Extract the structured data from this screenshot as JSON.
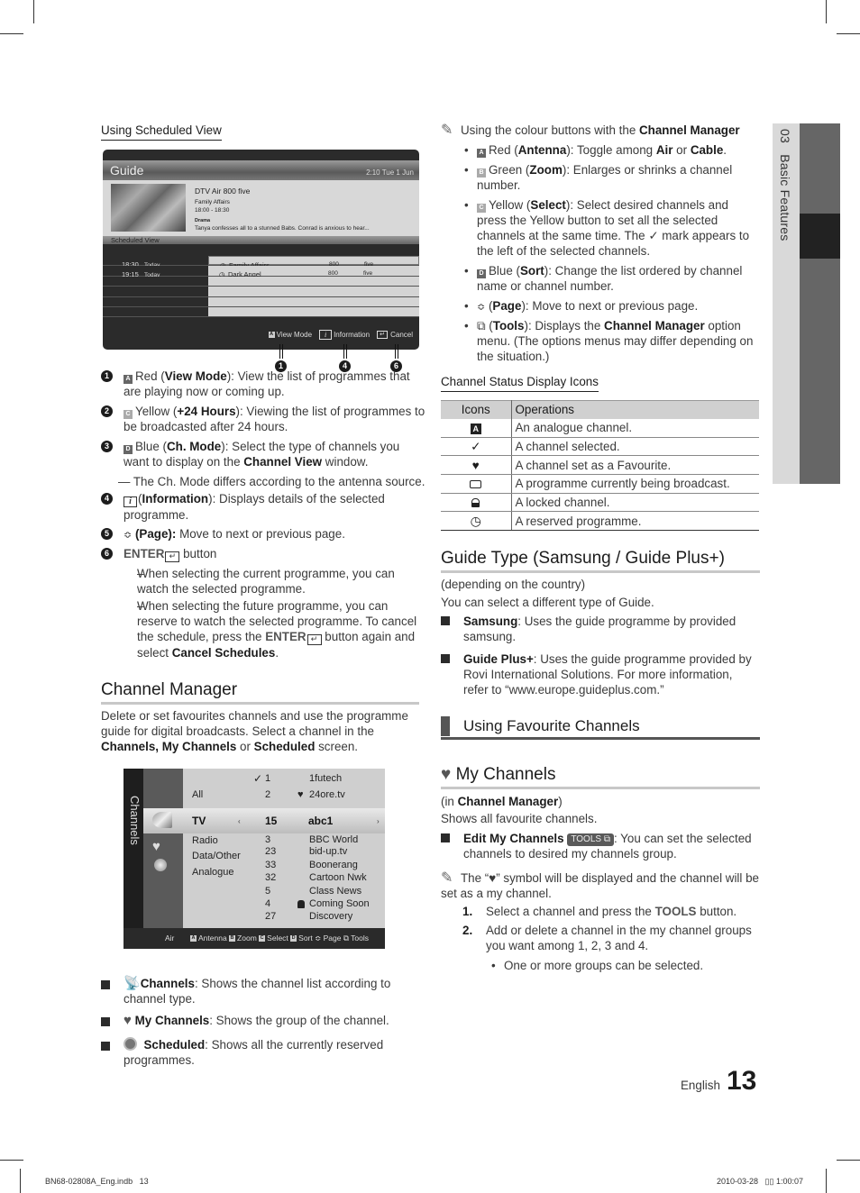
{
  "side_tab": {
    "chapter": "03",
    "title": "Basic Features"
  },
  "left": {
    "scheduled_view_heading": "Using Scheduled View",
    "guide_screen": {
      "title": "Guide",
      "clock": "2:10 Tue 1 Jun",
      "channel": "DTV Air 800 five",
      "programme": "Family Affairs",
      "time": "18:00 - 18:30",
      "genre": "Drama",
      "synopsis": "Tanya confesses all to a stunned Babs. Conrad is anxious to hear...",
      "view_label": "Scheduled View",
      "rows": [
        {
          "time": "18:30",
          "day": "Today",
          "title": "Family Affairs",
          "ch": "800",
          "name": "five"
        },
        {
          "time": "19:15",
          "day": "Today",
          "title": "Dark Angel",
          "ch": "800",
          "name": "five"
        }
      ],
      "footer": {
        "key_a": "A",
        "view_mode": "View Mode",
        "info_glyph": "i",
        "information": "Information",
        "enter_glyph": "↵",
        "cancel": "Cancel"
      },
      "callouts": [
        "1",
        "4",
        "6"
      ]
    },
    "items": [
      {
        "num": "1",
        "key": "A",
        "pre": "Red (",
        "bold": "View Mode",
        "post": "): View the list of programmes that are playing now or coming up."
      },
      {
        "num": "2",
        "key": "C",
        "pre": "Yellow (",
        "bold": "+24 Hours",
        "post": "): Viewing the list of programmes to be broadcasted after 24 hours."
      },
      {
        "num": "3",
        "key": "D",
        "pre": "Blue (",
        "bold": "Ch. Mode",
        "post": "): Select the type of channels you want to display on the ",
        "bold2": "Channel View",
        "post2": " window."
      }
    ],
    "note_ch_mode": "— The Ch. Mode differs according to the antenna source.",
    "item4": {
      "num": "4",
      "glyph": "i",
      "pre": "(",
      "bold": "Information",
      "post": "): Displays details of the selected programme."
    },
    "item5": {
      "num": "5",
      "glyph": "≎",
      "bold": "(Page):",
      "post": " Move to next or previous page."
    },
    "item6": {
      "num": "6",
      "bold": "ENTER",
      "glyph": "↵",
      "post": " button"
    },
    "dash1": "When selecting the current programme, you can watch the selected programme.",
    "dash2_pre": "When selecting the future programme, you can reserve to watch the selected programme. To cancel the schedule, press the ",
    "dash2_bold": "ENTER",
    "dash2_mid": " button again and select ",
    "dash2_bold2": "Cancel Schedules",
    "dash2_end": ".",
    "dash_glyph": "–",
    "channel_manager": {
      "heading": "Channel Manager",
      "intro_pre": "Delete or set favourites channels and use the programme guide for digital broadcasts. Select a channel in the ",
      "intro_bold": "Channels, My Channels",
      "intro_mid": " or ",
      "intro_bold2": "Scheduled",
      "intro_end": " screen."
    },
    "cm_screen": {
      "side_label": "Channels",
      "categories": [
        "All",
        "TV",
        "Radio",
        "Data/Other",
        "Analogue"
      ],
      "rows": [
        {
          "num": "1",
          "name": "1futech",
          "mark": "check"
        },
        {
          "num": "2",
          "name": "24ore.tv",
          "mark": "heart"
        },
        {
          "num": "15",
          "name": "abc1",
          "mark": ""
        },
        {
          "num": "3",
          "name": "BBC World",
          "mark": ""
        },
        {
          "num": "23",
          "name": "bid-up.tv",
          "mark": ""
        },
        {
          "num": "33",
          "name": "Boonerang",
          "mark": ""
        },
        {
          "num": "32",
          "name": "Cartoon Nwk",
          "mark": ""
        },
        {
          "num": "5",
          "name": "Class News",
          "mark": ""
        },
        {
          "num": "4",
          "name": "Coming Soon",
          "mark": "lock"
        },
        {
          "num": "27",
          "name": "Discovery",
          "mark": ""
        }
      ],
      "footer": {
        "source": "Air",
        "a": "A",
        "antenna": "Antenna",
        "b": "B",
        "zoom": "Zoom",
        "c": "C",
        "select": "Select",
        "d": "D",
        "sort": "Sort",
        "page_glyph": "≎",
        "page": "Page",
        "tools": "Tools"
      }
    },
    "bullets": [
      {
        "bold": "Channels",
        "text": ": Shows the channel list according to channel type."
      },
      {
        "bold": "My Channels",
        "text": ": Shows the group of the channel."
      },
      {
        "bold": "Scheduled",
        "text": ": Shows all the currently reserved programmes."
      }
    ]
  },
  "right": {
    "note_pre": "Using the colour buttons with the ",
    "note_bold": "Channel Manager",
    "colour_items": [
      {
        "key": "A",
        "pre": "Red (",
        "bold": "Antenna",
        "mid": "): Toggle among ",
        "b2": "Air",
        "mid2": " or ",
        "b3": "Cable",
        "end": "."
      },
      {
        "key": "B",
        "pre": "Green (",
        "bold": "Zoom",
        "mid": "): Enlarges or shrinks a channel number."
      },
      {
        "key": "C",
        "pre": "Yellow (",
        "bold": "Select",
        "mid": "): Select desired channels and press the Yellow button to set all the selected channels at the same time. The ",
        "check": "✓",
        "end": " mark appears to the left of the selected channels."
      },
      {
        "key": "D",
        "pre": "Blue (",
        "bold": "Sort",
        "mid": "): Change the list ordered by channel name or channel number."
      },
      {
        "glyph": "≎",
        "pre": "(",
        "bold": "Page",
        "mid": "): Move to next or previous page."
      },
      {
        "glyph": "tools",
        "pre": "(",
        "bold": "Tools",
        "mid": "): Displays the ",
        "b2": "Channel Manager",
        "end": " option menu. (The options menus may differ depending on the situation.)"
      }
    ],
    "bullet_glyph": "•",
    "status_heading": "Channel Status Display Icons",
    "table": {
      "headers": [
        "Icons",
        "Operations"
      ],
      "rows": [
        {
          "icon": "A",
          "op": "An analogue channel."
        },
        {
          "icon": "✓",
          "op": "A channel selected."
        },
        {
          "icon": "♥",
          "op": "A channel set as a Favourite."
        },
        {
          "icon": "tv",
          "op": "A programme currently being broadcast."
        },
        {
          "icon": "lock",
          "op": "A locked channel."
        },
        {
          "icon": "clock",
          "op": "A reserved programme."
        }
      ]
    },
    "guide_type": {
      "heading": "Guide Type (Samsung / Guide Plus+)",
      "line1": "(depending on the country)",
      "line2": "You can select a different type of Guide.",
      "items": [
        {
          "bold": "Samsung",
          "text": ": Uses the guide programme by provided samsung."
        },
        {
          "bold": "Guide Plus+",
          "text": ": Uses the guide programme provided by Rovi International Solutions. For more information, refer to “www.europe.guideplus.com.”"
        }
      ]
    },
    "fav_heading": "Using Favourite Channels",
    "my_channels": {
      "heart": "♥",
      "heading": "My Channels",
      "in_pre": "(in ",
      "in_bold": "Channel Manager",
      "in_end": ")",
      "shows": "Shows all favourite channels.",
      "edit_bold": "Edit My Channels",
      "tools_badge": "TOOLS",
      "edit_text": ": You can set the selected channels to desired my channels group.",
      "note_pre": "The “",
      "note_heart": "♥",
      "note_post": "” symbol will be displayed and the channel will be set as a my channel.",
      "steps": [
        {
          "n": "1.",
          "pre": "Select a channel and press the ",
          "bold": "TOOLS",
          "post": " button."
        },
        {
          "n": "2.",
          "pre": "Add or delete a channel in the my channel groups you want among 1, 2, 3 and 4.",
          "bold": "",
          "post": ""
        }
      ],
      "sub_bullet": "One or more groups can be selected."
    }
  },
  "footer": {
    "language": "English",
    "page": "13",
    "file": "BN68-02808A_Eng.indb   13",
    "datestamp": "2010-03-28   ▯▯ 1:00:07"
  }
}
